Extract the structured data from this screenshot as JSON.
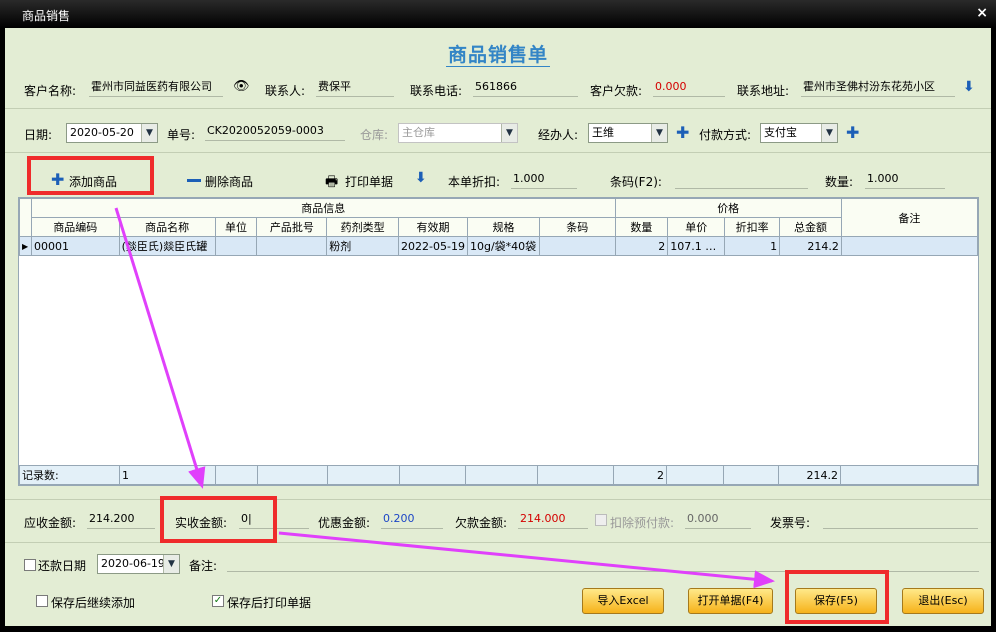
{
  "window": {
    "title": "商品销售",
    "close": "×"
  },
  "form_title": "商品销售单",
  "row1": {
    "customer_label": "客户名称:",
    "customer_value": "霍州市同益医药有限公司",
    "contact_label": "联系人:",
    "contact_value": "费保平",
    "phone_label": "联系电话:",
    "phone_value": "561866",
    "debt_label": "客户欠款:",
    "debt_value": "0.000",
    "address_label": "联系地址:",
    "address_value": "霍州市圣佛村汾东花苑小区"
  },
  "row2": {
    "date_label": "日期:",
    "date_value": "2020-05-20",
    "order_label": "单号:",
    "order_value": "CK2020052059-0003",
    "warehouse_label": "仓库:",
    "warehouse_value": "主仓库",
    "handler_label": "经办人:",
    "handler_value": "王维",
    "pay_label": "付款方式:",
    "pay_value": "支付宝"
  },
  "toolbar": {
    "add": "添加商品",
    "delete": "删除商品",
    "print": "打印单据",
    "discount_label": "本单折扣:",
    "discount_value": "1.000",
    "barcode_label": "条码(F2):",
    "barcode_value": "",
    "qty_label": "数量:",
    "qty_value": "1.000"
  },
  "grid": {
    "group_goods": "商品信息",
    "group_price": "价格",
    "remark": "备注",
    "columns": [
      "商品编码",
      "商品名称",
      "单位",
      "产品批号",
      "药剂类型",
      "有效期",
      "规格",
      "条码",
      "数量",
      "单价",
      "折扣率",
      "总金额"
    ],
    "rows": [
      [
        "00001",
        "(燚臣氏)燚臣氏罐",
        "",
        "",
        "粉剂",
        "2022-05-19",
        "10g/袋*40袋",
        "",
        "2",
        "107.1 …",
        "1",
        "214.2"
      ]
    ],
    "footer_label": "记录数:",
    "footer_count": "1",
    "footer_qty": "2",
    "footer_total": "214.2"
  },
  "totals": {
    "receivable_label": "应收金额:",
    "receivable_value": "214.200",
    "received_label": "实收金额:",
    "received_value": "0|",
    "discount_label": "优惠金额:",
    "discount_value": "0.200",
    "owed_label": "欠款金额:",
    "owed_value": "214.000",
    "prepay_label": "扣除预付款:",
    "prepay_value": "0.000",
    "invoice_label": "发票号:",
    "invoice_value": ""
  },
  "bottom": {
    "return_date_label": "还款日期",
    "return_date_value": "2020-06-19",
    "note_label": "备注:",
    "note_value": "",
    "continue_label": "保存后继续添加",
    "print_after_label": "保存后打印单据"
  },
  "buttons": {
    "import_excel": "导入Excel",
    "open": "打开单据(F4)",
    "save": "保存(F5)",
    "exit": "退出(Esc)"
  },
  "colors": {
    "accent": "#3385c6",
    "highlight_box": "#ef2b2b",
    "arrow": "#e040fb",
    "debt": "#d40000",
    "discount": "#1d46c6"
  },
  "checkbox_state": {
    "return_date": false,
    "continue": false,
    "print_after": true
  }
}
